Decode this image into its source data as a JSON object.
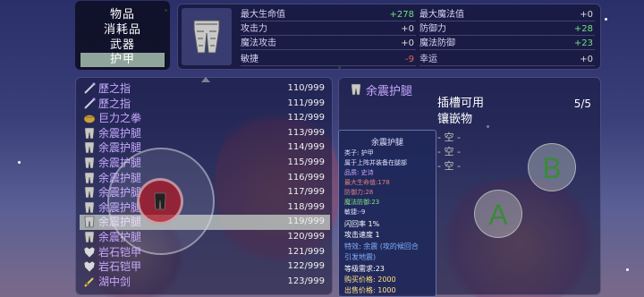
{
  "categories": [
    {
      "label": "物品",
      "selected": false
    },
    {
      "label": "消耗品",
      "selected": false
    },
    {
      "label": "武器",
      "selected": false
    },
    {
      "label": "护甲",
      "selected": true
    }
  ],
  "stats": {
    "left": [
      {
        "label": "最大生命值",
        "value": "+278",
        "tone": "pos"
      },
      {
        "label": "攻击力",
        "value": "+0",
        "tone": "neutral"
      },
      {
        "label": "魔法攻击",
        "value": "+0",
        "tone": "neutral"
      },
      {
        "label": "敏捷",
        "value": "-9",
        "tone": "neg"
      }
    ],
    "right": [
      {
        "label": "最大魔法值",
        "value": "+0",
        "tone": "neutral"
      },
      {
        "label": "防御力",
        "value": "+28",
        "tone": "pos"
      },
      {
        "label": "魔法防御",
        "value": "+23",
        "tone": "pos"
      },
      {
        "label": "幸运",
        "value": "+0",
        "tone": "neutral"
      }
    ]
  },
  "items": [
    {
      "icon": "wand-icon",
      "name": "歷之指",
      "count": "110/999",
      "selected": false
    },
    {
      "icon": "wand-icon",
      "name": "歷之指",
      "count": "111/999",
      "selected": false
    },
    {
      "icon": "fist-icon",
      "name": "巨力之拳",
      "count": "112/999",
      "selected": false
    },
    {
      "icon": "legguard-icon",
      "name": "余震护腿",
      "count": "113/999",
      "selected": false
    },
    {
      "icon": "legguard-icon",
      "name": "余震护腿",
      "count": "114/999",
      "selected": false
    },
    {
      "icon": "legguard-icon",
      "name": "余震护腿",
      "count": "115/999",
      "selected": false
    },
    {
      "icon": "legguard-icon",
      "name": "余震护腿",
      "count": "116/999",
      "selected": false
    },
    {
      "icon": "legguard-icon",
      "name": "余震护腿",
      "count": "117/999",
      "selected": false
    },
    {
      "icon": "legguard-icon",
      "name": "余震护腿",
      "count": "118/999",
      "selected": false
    },
    {
      "icon": "legguard-icon",
      "name": "余震护腿",
      "count": "119/999",
      "selected": true
    },
    {
      "icon": "legguard-icon",
      "name": "余震护腿",
      "count": "120/999",
      "selected": false
    },
    {
      "icon": "rock-armor-icon",
      "name": "岩石铠甲",
      "count": "121/999",
      "selected": false
    },
    {
      "icon": "rock-armor-icon",
      "name": "岩石铠甲",
      "count": "122/999",
      "selected": false
    },
    {
      "icon": "sword-icon",
      "name": "湖中剑",
      "count": "123/999",
      "selected": false
    }
  ],
  "detail": {
    "title": "余震护腿",
    "socket_label_1": "插槽可用",
    "socket_label_2": "镶嵌物",
    "socket_count": "5/5",
    "slots": [
      "- 空 -",
      "- 空 -",
      "- 空 -"
    ]
  },
  "tooltip": {
    "title": "余震护腿",
    "lines": [
      {
        "text": "类子: 护甲",
        "color": "#e0e0ff"
      },
      {
        "text": "属于上阵并装备在腿部",
        "color": "#e0e0ff"
      },
      {
        "text": "品质: 史诗",
        "color": "#c8a8ff"
      },
      {
        "text": "最大生命值:178",
        "color": "#e08080"
      },
      {
        "text": "防御力:28",
        "color": "#e08080"
      },
      {
        "text": "魔法防御:23",
        "color": "#80e080"
      },
      {
        "text": "敏捷:-9",
        "color": "#e0e0ff"
      },
      {
        "text": "闪回率 1%",
        "color": "#ffffff"
      },
      {
        "text": "攻击速度 1",
        "color": "#ffffff"
      },
      {
        "text": "特效: 余震 (攻的候回合",
        "color": "#80b0ff"
      },
      {
        "text": "引发地震)",
        "color": "#80b0ff"
      },
      {
        "text": "等级需求:23",
        "color": "#ffffff"
      },
      {
        "text": "购买价格: 2000",
        "color": "#ffe080"
      },
      {
        "text": "出售价格: 1000",
        "color": "#ffe080"
      }
    ]
  },
  "controls": {
    "button_a": "A",
    "button_b": "B"
  },
  "colors": {
    "highlight": "#8fa59c",
    "item_name": "#c8a8ff",
    "positive": "#6fe07a",
    "negative": "#e06060"
  }
}
